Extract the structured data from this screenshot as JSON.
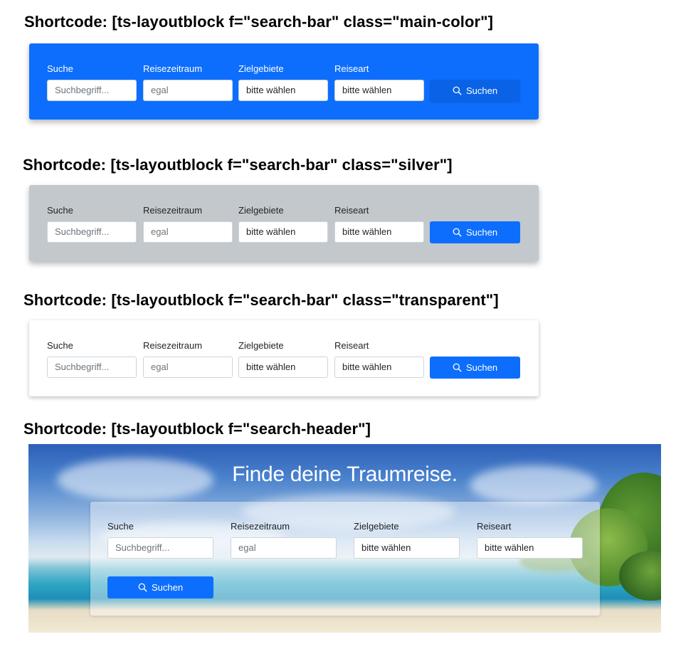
{
  "headings": {
    "main_color": "Shortcode: [ts-layoutblock f=\"search-bar\" class=\"main-color\"]",
    "silver": "Shortcode: [ts-layoutblock f=\"search-bar\" class=\"silver\"]",
    "transparent": "Shortcode: [ts-layoutblock f=\"search-bar\" class=\"transparent\"]",
    "search_header": "Shortcode: [ts-layoutblock f=\"search-header\"]"
  },
  "form": {
    "labels": {
      "search": "Suche",
      "period": "Reisezeitraum",
      "destinations": "Zielgebiete",
      "travel_type": "Reiseart"
    },
    "search_placeholder": "Suchbegriff...",
    "period_value": "egal",
    "destinations_value": "bitte wählen",
    "travel_type_value": "bitte wählen",
    "search_button": "Suchen"
  },
  "hero": {
    "title": "Finde deine Traumreise."
  },
  "colors": {
    "main": "#0d6efd",
    "silver": "#c2c8cc",
    "transparent": "#ffffff"
  },
  "icons": {
    "search_button_icon": "search-icon"
  }
}
